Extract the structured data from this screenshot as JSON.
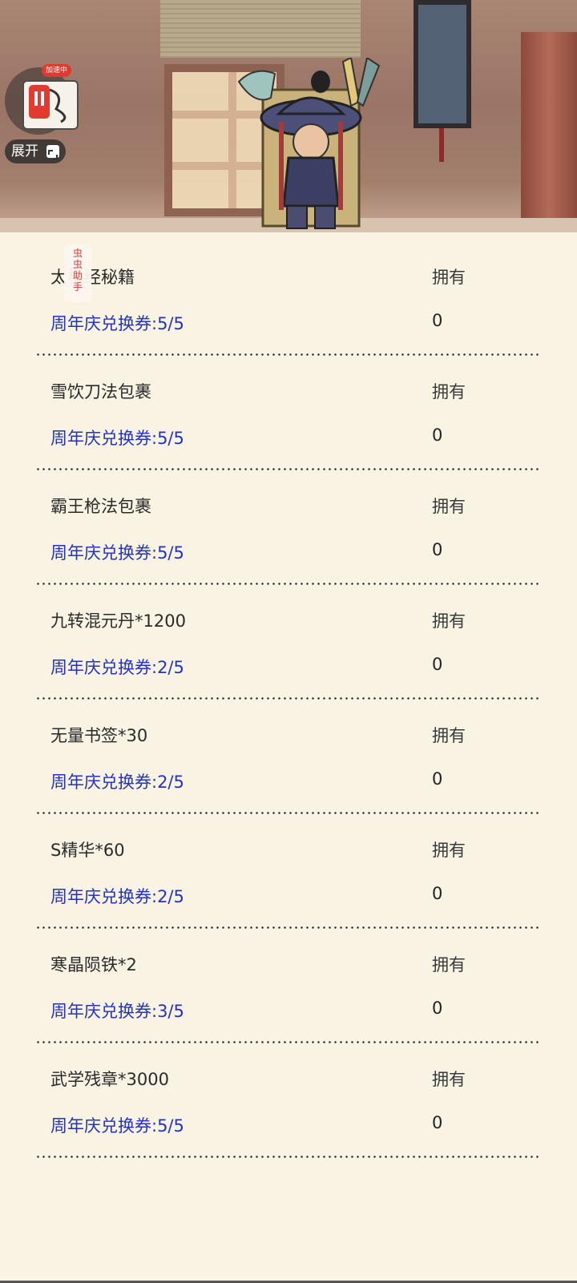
{
  "overlay": {
    "badge": "加速中",
    "expand_label": "展开",
    "tag_label": "虫虫助手"
  },
  "column_header": "拥有",
  "items": [
    {
      "name": "太极经秘籍",
      "own_label": "拥有",
      "cost": "周年庆兑换券:5/5",
      "owned": "0"
    },
    {
      "name": "雪饮刀法包裹",
      "own_label": "拥有",
      "cost": "周年庆兑换券:5/5",
      "owned": "0"
    },
    {
      "name": "霸王枪法包裹",
      "own_label": "拥有",
      "cost": "周年庆兑换券:5/5",
      "owned": "0"
    },
    {
      "name": "九转混元丹*1200",
      "own_label": "拥有",
      "cost": "周年庆兑换券:2/5",
      "owned": "0"
    },
    {
      "name": "无量书签*30",
      "own_label": "拥有",
      "cost": "周年庆兑换券:2/5",
      "owned": "0"
    },
    {
      "name": "S精华*60",
      "own_label": "拥有",
      "cost": "周年庆兑换券:2/5",
      "owned": "0"
    },
    {
      "name": "寒晶陨铁*2",
      "own_label": "拥有",
      "cost": "周年庆兑换券:3/5",
      "owned": "0"
    },
    {
      "name": "武学残章*3000",
      "own_label": "拥有",
      "cost": "周年庆兑换券:5/5",
      "owned": "0"
    }
  ],
  "colors": {
    "background": "#f9f3e3",
    "cost_text": "#2233c4",
    "separator": "#222222"
  }
}
